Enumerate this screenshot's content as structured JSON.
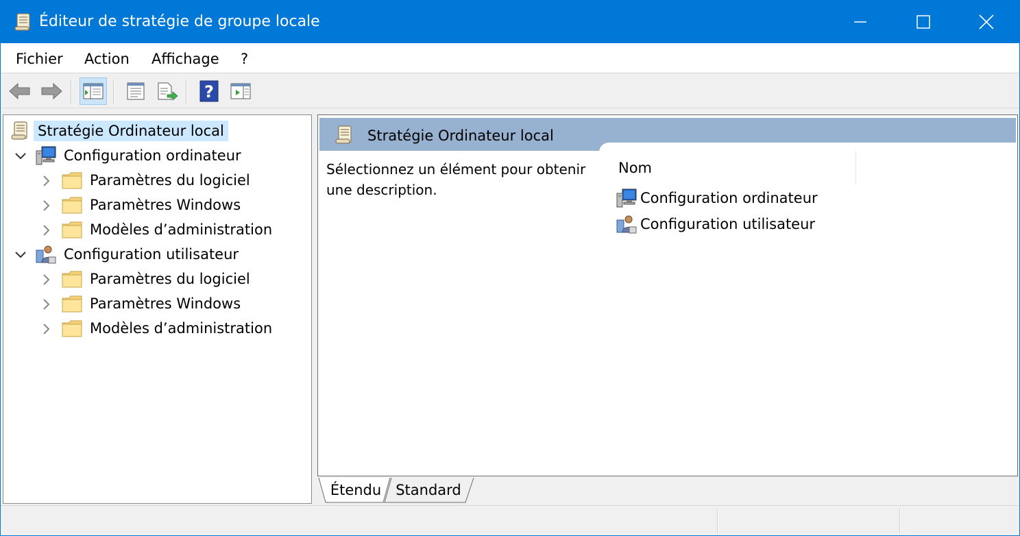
{
  "window": {
    "title": "Éditeur de stratégie de groupe locale",
    "icon": "policy-scroll-icon",
    "accent_color": "#0078d7"
  },
  "menu": {
    "items": [
      "Fichier",
      "Action",
      "Affichage",
      "?"
    ]
  },
  "toolbar": {
    "buttons": [
      {
        "icon": "back-arrow-icon",
        "active": false
      },
      {
        "icon": "forward-arrow-icon",
        "active": false
      },
      {
        "icon": "show-hide-console-tree-icon",
        "active": true
      },
      {
        "icon": "properties-icon",
        "active": false
      },
      {
        "icon": "export-list-icon",
        "active": false
      },
      {
        "icon": "help-icon",
        "active": false
      },
      {
        "icon": "show-hide-action-pane-icon",
        "active": false
      }
    ]
  },
  "tree": {
    "root": {
      "label": "Stratégie Ordinateur local",
      "icon": "policy-scroll-icon",
      "selected": true
    },
    "computer": {
      "label": "Configuration ordinateur",
      "icon": "computer-config-icon",
      "expanded": true,
      "children": [
        {
          "label": "Paramètres du logiciel",
          "icon": "folder-icon"
        },
        {
          "label": "Paramètres Windows",
          "icon": "folder-icon"
        },
        {
          "label": "Modèles d’administration",
          "icon": "folder-icon"
        }
      ]
    },
    "user": {
      "label": "Configuration utilisateur",
      "icon": "user-config-icon",
      "expanded": true,
      "children": [
        {
          "label": "Paramètres du logiciel",
          "icon": "folder-icon"
        },
        {
          "label": "Paramètres Windows",
          "icon": "folder-icon"
        },
        {
          "label": "Modèles d’administration",
          "icon": "folder-icon"
        }
      ]
    }
  },
  "details": {
    "header_title": "Stratégie Ordinateur local",
    "description": "Sélectionnez un élément pour obtenir une description.",
    "column_name": "Nom",
    "items": [
      {
        "label": "Configuration ordinateur",
        "icon": "computer-config-icon"
      },
      {
        "label": "Configuration utilisateur",
        "icon": "user-config-icon"
      }
    ]
  },
  "tabs": {
    "extended": "Étendu",
    "standard": "Standard",
    "active": "Étendu"
  }
}
